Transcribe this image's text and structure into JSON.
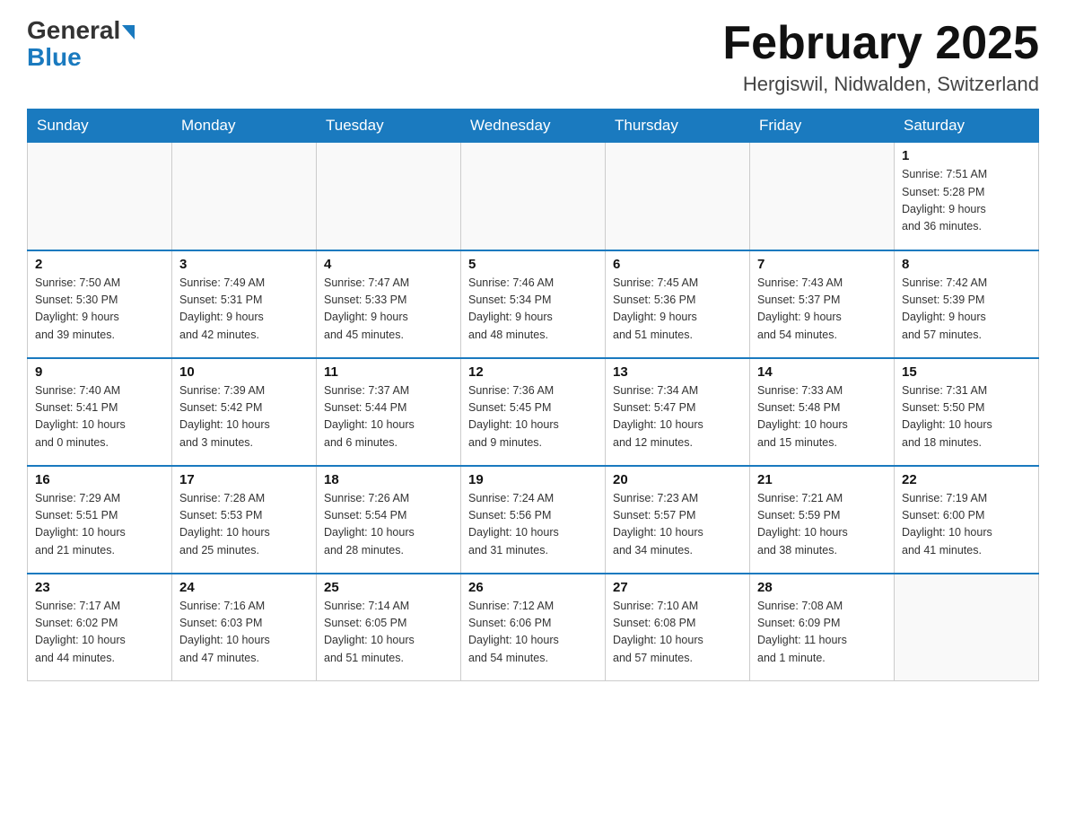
{
  "header": {
    "logo_general": "General",
    "logo_blue": "Blue",
    "title": "February 2025",
    "subtitle": "Hergiswil, Nidwalden, Switzerland"
  },
  "weekdays": [
    "Sunday",
    "Monday",
    "Tuesday",
    "Wednesday",
    "Thursday",
    "Friday",
    "Saturday"
  ],
  "weeks": [
    [
      {
        "day": "",
        "info": ""
      },
      {
        "day": "",
        "info": ""
      },
      {
        "day": "",
        "info": ""
      },
      {
        "day": "",
        "info": ""
      },
      {
        "day": "",
        "info": ""
      },
      {
        "day": "",
        "info": ""
      },
      {
        "day": "1",
        "info": "Sunrise: 7:51 AM\nSunset: 5:28 PM\nDaylight: 9 hours\nand 36 minutes."
      }
    ],
    [
      {
        "day": "2",
        "info": "Sunrise: 7:50 AM\nSunset: 5:30 PM\nDaylight: 9 hours\nand 39 minutes."
      },
      {
        "day": "3",
        "info": "Sunrise: 7:49 AM\nSunset: 5:31 PM\nDaylight: 9 hours\nand 42 minutes."
      },
      {
        "day": "4",
        "info": "Sunrise: 7:47 AM\nSunset: 5:33 PM\nDaylight: 9 hours\nand 45 minutes."
      },
      {
        "day": "5",
        "info": "Sunrise: 7:46 AM\nSunset: 5:34 PM\nDaylight: 9 hours\nand 48 minutes."
      },
      {
        "day": "6",
        "info": "Sunrise: 7:45 AM\nSunset: 5:36 PM\nDaylight: 9 hours\nand 51 minutes."
      },
      {
        "day": "7",
        "info": "Sunrise: 7:43 AM\nSunset: 5:37 PM\nDaylight: 9 hours\nand 54 minutes."
      },
      {
        "day": "8",
        "info": "Sunrise: 7:42 AM\nSunset: 5:39 PM\nDaylight: 9 hours\nand 57 minutes."
      }
    ],
    [
      {
        "day": "9",
        "info": "Sunrise: 7:40 AM\nSunset: 5:41 PM\nDaylight: 10 hours\nand 0 minutes."
      },
      {
        "day": "10",
        "info": "Sunrise: 7:39 AM\nSunset: 5:42 PM\nDaylight: 10 hours\nand 3 minutes."
      },
      {
        "day": "11",
        "info": "Sunrise: 7:37 AM\nSunset: 5:44 PM\nDaylight: 10 hours\nand 6 minutes."
      },
      {
        "day": "12",
        "info": "Sunrise: 7:36 AM\nSunset: 5:45 PM\nDaylight: 10 hours\nand 9 minutes."
      },
      {
        "day": "13",
        "info": "Sunrise: 7:34 AM\nSunset: 5:47 PM\nDaylight: 10 hours\nand 12 minutes."
      },
      {
        "day": "14",
        "info": "Sunrise: 7:33 AM\nSunset: 5:48 PM\nDaylight: 10 hours\nand 15 minutes."
      },
      {
        "day": "15",
        "info": "Sunrise: 7:31 AM\nSunset: 5:50 PM\nDaylight: 10 hours\nand 18 minutes."
      }
    ],
    [
      {
        "day": "16",
        "info": "Sunrise: 7:29 AM\nSunset: 5:51 PM\nDaylight: 10 hours\nand 21 minutes."
      },
      {
        "day": "17",
        "info": "Sunrise: 7:28 AM\nSunset: 5:53 PM\nDaylight: 10 hours\nand 25 minutes."
      },
      {
        "day": "18",
        "info": "Sunrise: 7:26 AM\nSunset: 5:54 PM\nDaylight: 10 hours\nand 28 minutes."
      },
      {
        "day": "19",
        "info": "Sunrise: 7:24 AM\nSunset: 5:56 PM\nDaylight: 10 hours\nand 31 minutes."
      },
      {
        "day": "20",
        "info": "Sunrise: 7:23 AM\nSunset: 5:57 PM\nDaylight: 10 hours\nand 34 minutes."
      },
      {
        "day": "21",
        "info": "Sunrise: 7:21 AM\nSunset: 5:59 PM\nDaylight: 10 hours\nand 38 minutes."
      },
      {
        "day": "22",
        "info": "Sunrise: 7:19 AM\nSunset: 6:00 PM\nDaylight: 10 hours\nand 41 minutes."
      }
    ],
    [
      {
        "day": "23",
        "info": "Sunrise: 7:17 AM\nSunset: 6:02 PM\nDaylight: 10 hours\nand 44 minutes."
      },
      {
        "day": "24",
        "info": "Sunrise: 7:16 AM\nSunset: 6:03 PM\nDaylight: 10 hours\nand 47 minutes."
      },
      {
        "day": "25",
        "info": "Sunrise: 7:14 AM\nSunset: 6:05 PM\nDaylight: 10 hours\nand 51 minutes."
      },
      {
        "day": "26",
        "info": "Sunrise: 7:12 AM\nSunset: 6:06 PM\nDaylight: 10 hours\nand 54 minutes."
      },
      {
        "day": "27",
        "info": "Sunrise: 7:10 AM\nSunset: 6:08 PM\nDaylight: 10 hours\nand 57 minutes."
      },
      {
        "day": "28",
        "info": "Sunrise: 7:08 AM\nSunset: 6:09 PM\nDaylight: 11 hours\nand 1 minute."
      },
      {
        "day": "",
        "info": ""
      }
    ]
  ]
}
